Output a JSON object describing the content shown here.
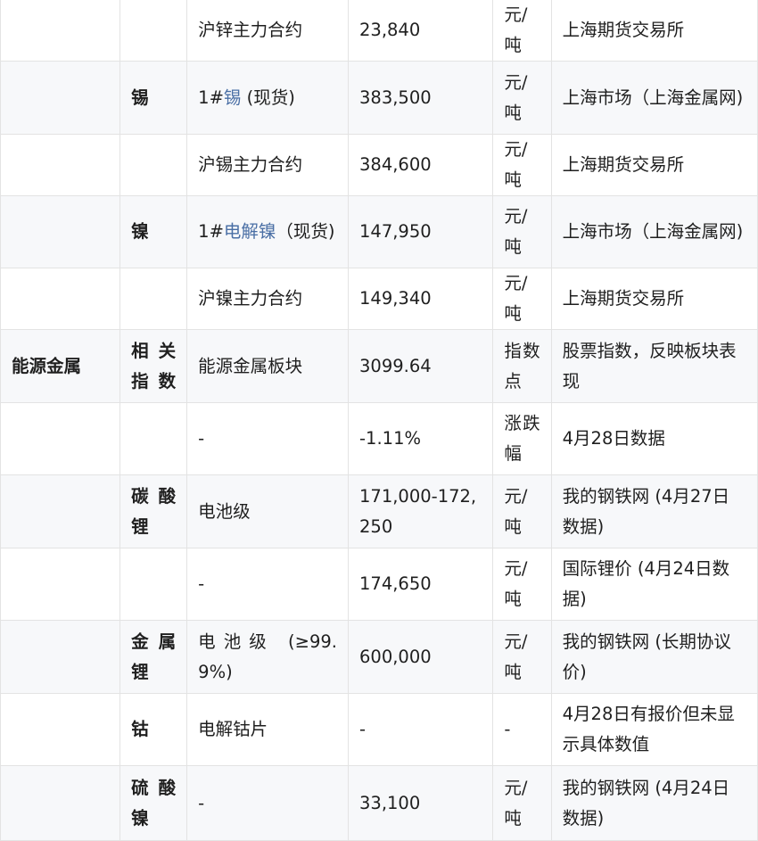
{
  "table": {
    "rows": [
      {
        "category": "",
        "subcategory": "",
        "name": "沪锌主力合约",
        "price": "23,840",
        "unit": "元/吨",
        "source": "上海期货交易所"
      },
      {
        "category": "",
        "subcategory": "锡",
        "name_prefix": "1#",
        "name_link": "锡",
        "name_suffix": " (现货)",
        "price": "383,500",
        "unit": "元/吨",
        "source": "上海市场（上海金属网)"
      },
      {
        "category": "",
        "subcategory": "",
        "name": "沪锡主力合约",
        "price": "384,600",
        "unit": "元/吨",
        "source": "上海期货交易所"
      },
      {
        "category": "",
        "subcategory": "镍",
        "name_prefix": "1#",
        "name_link": "电解镍",
        "name_suffix": "（现货)",
        "price": "147,950",
        "unit": "元/吨",
        "source": "上海市场（上海金属网)"
      },
      {
        "category": "",
        "subcategory": "",
        "name": "沪镍主力合约",
        "price": "149,340",
        "unit": "元/吨",
        "source": "上海期货交易所"
      },
      {
        "category": "能源金属",
        "subcategory": "相关指数",
        "name": "能源金属板块",
        "price": "3099.64",
        "unit": "指数点",
        "source": "股票指数，反映板块表现"
      },
      {
        "category": "",
        "subcategory": "",
        "name": "-",
        "price": "-1.11%",
        "unit": "涨跌幅",
        "source": "4月28日数据"
      },
      {
        "category": "",
        "subcategory": "碳酸锂",
        "name": "电池级",
        "price": "171,000-172,250",
        "unit": "元/吨",
        "source": "我的钢铁网 (4月27日数据)"
      },
      {
        "category": "",
        "subcategory": "",
        "name": "-",
        "price": "174,650",
        "unit": "元/吨",
        "source": "国际锂价 (4月24日数据)"
      },
      {
        "category": "",
        "subcategory": "金属锂",
        "name": "电池级 (≥99.9%)",
        "price": "600,000",
        "unit": "元/吨",
        "source": "我的钢铁网 (长期协议价)"
      },
      {
        "category": "",
        "subcategory": "钴",
        "name": "电解钴片",
        "price": "-",
        "unit": "-",
        "source": "4月28日有报价但未显示具体数值"
      },
      {
        "category": "",
        "subcategory": "硫酸镍",
        "name": "-",
        "price": "33,100",
        "unit": "元/吨",
        "source": "我的钢铁网 (4月24日数据)"
      }
    ]
  }
}
